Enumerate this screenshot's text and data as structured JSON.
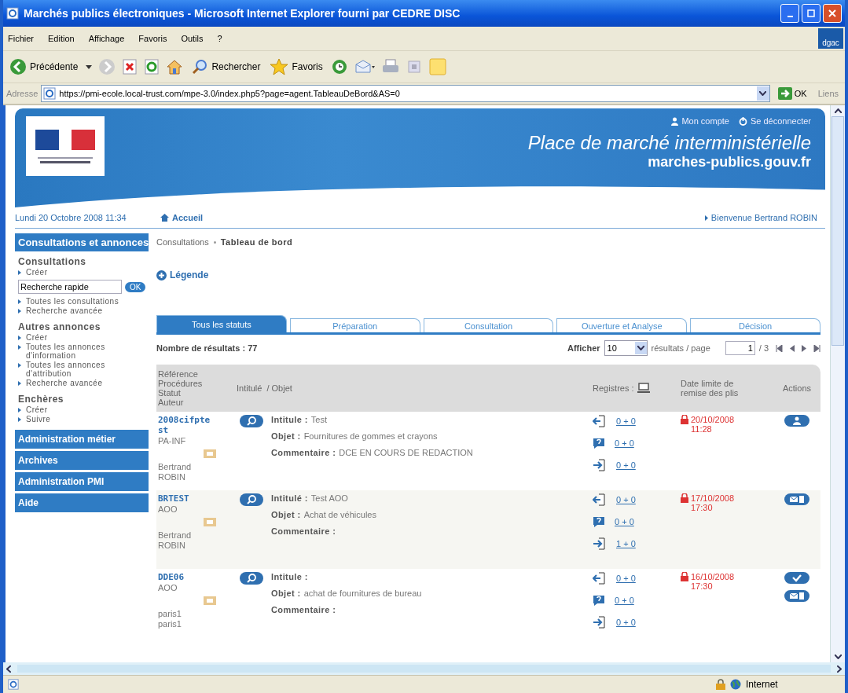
{
  "window": {
    "title": "Marchés publics électroniques - Microsoft Internet Explorer fourni par CEDRE DISC",
    "badge": "dgac"
  },
  "menu": [
    {
      "label": "Fichier"
    },
    {
      "label": "Edition"
    },
    {
      "label": "Affichage"
    },
    {
      "label": "Favoris"
    },
    {
      "label": "Outils"
    },
    {
      "label": "?"
    }
  ],
  "toolbar": {
    "back": "Précédente",
    "search": "Rechercher",
    "favorites": "Favoris"
  },
  "address": {
    "label": "Adresse",
    "url": "https://pmi-ecole.local-trust.com/mpe-3.0/index.php5?page=agent.TableauDeBord&AS=0",
    "go": "OK",
    "links": "Liens"
  },
  "header": {
    "account": "Mon compte",
    "logout": "Se déconnecter",
    "title": "Place de marché interministérielle",
    "subtitle": "marches-publics.gouv.fr"
  },
  "date": "Lundi 20 Octobre 2008 11:34",
  "home": "Accueil",
  "welcome": "Bienvenue Bertrand ROBIN",
  "sidebar": {
    "title": "Consultations et annonces",
    "groups": [
      {
        "heading": "Consultations",
        "items": [
          {
            "kind": "link",
            "label": "Créer"
          },
          {
            "kind": "search",
            "value": "Recherche rapide",
            "button": "OK"
          },
          {
            "kind": "link",
            "label": "Toutes les consultations"
          },
          {
            "kind": "link",
            "label": "Recherche avancée"
          }
        ]
      },
      {
        "heading": "Autres annonces",
        "items": [
          {
            "kind": "link",
            "label": "Créer"
          },
          {
            "kind": "link",
            "label": "Toutes les annonces d'information"
          },
          {
            "kind": "link",
            "label": "Toutes les annonces d'attribution"
          },
          {
            "kind": "link",
            "label": "Recherche avancée"
          }
        ]
      },
      {
        "heading": "Enchères",
        "items": [
          {
            "kind": "link",
            "label": "Créer"
          },
          {
            "kind": "link",
            "label": "Suivre"
          }
        ]
      }
    ],
    "nav": [
      "Administration métier",
      "Archives",
      "Administration PMI",
      "Aide"
    ]
  },
  "breadcrumb": [
    "Consultations",
    "Tableau de bord"
  ],
  "legend": "Légende",
  "tabs": [
    {
      "label": "Tous les statuts",
      "selected": true
    },
    {
      "label": "Préparation",
      "selected": false
    },
    {
      "label": "Consultation",
      "selected": false
    },
    {
      "label": "Ouverture et Analyse",
      "selected": false
    },
    {
      "label": "Décision",
      "selected": false
    }
  ],
  "results": "Nombre de résultats : 77",
  "pager": {
    "show": "Afficher",
    "per_page": "10",
    "per_page_label": "résultats / page",
    "page": "1",
    "total": "/ 3"
  },
  "table": {
    "columns": {
      "ref": [
        "Référence",
        "Procédures",
        "Statut",
        "Auteur"
      ],
      "title": "Intitulé",
      "object": "/ Objet",
      "registers": "Registres :",
      "deadline": "Date limite de remise des plis",
      "actions": "Actions"
    },
    "rows": [
      {
        "ref": "2008cifpte st",
        "procedure": "PA-INF",
        "author": [
          "Bertrand",
          "ROBIN"
        ],
        "fields": [
          {
            "label": "Intitule :",
            "value": "Test"
          },
          {
            "label": "Objet :",
            "value": "Fournitures de gommes et crayons"
          },
          {
            "label": "Commentaire :",
            "value": "DCE EN COURS DE REDACTION"
          }
        ],
        "registers": [
          {
            "kind": "withdrawal",
            "count": "0 + 0"
          },
          {
            "kind": "question",
            "count": "0 + 0"
          },
          {
            "kind": "deposit",
            "count": "0 + 0"
          }
        ],
        "date": "20/10/2008",
        "time": "11:28",
        "actions": [
          {
            "kind": "user"
          }
        ]
      },
      {
        "ref": "BRTEST",
        "procedure": "AOO",
        "author": [
          "Bertrand",
          "ROBIN"
        ],
        "fields": [
          {
            "label": "Intitulé :",
            "value": "Test AOO"
          },
          {
            "label": "Objet :",
            "value": "Achat de véhicules"
          },
          {
            "label": "Commentaire :"
          }
        ],
        "registers": [
          {
            "kind": "withdrawal",
            "count": "0 + 0"
          },
          {
            "kind": "question",
            "count": "0 + 0"
          },
          {
            "kind": "deposit",
            "count": "1 + 0"
          }
        ],
        "date": "17/10/2008",
        "time": "17:30",
        "actions": [
          {
            "kind": "mail"
          }
        ]
      },
      {
        "ref": "DDE06",
        "procedure": "AOO",
        "author": [
          "paris1",
          "paris1"
        ],
        "fields": [
          {
            "label": "Intitule :"
          },
          {
            "label": "Objet :",
            "value": "achat de fournitures de bureau"
          },
          {
            "label": "Commentaire :"
          }
        ],
        "registers": [
          {
            "kind": "withdrawal",
            "count": "0 + 0"
          },
          {
            "kind": "question",
            "count": "0 + 0"
          },
          {
            "kind": "deposit",
            "count": "0 + 0"
          }
        ],
        "date": "16/10/2008",
        "time": "17:30",
        "actions": [
          {
            "kind": "check"
          },
          {
            "kind": "mail"
          }
        ]
      }
    ]
  },
  "status_bar": {
    "zone": "Internet"
  }
}
